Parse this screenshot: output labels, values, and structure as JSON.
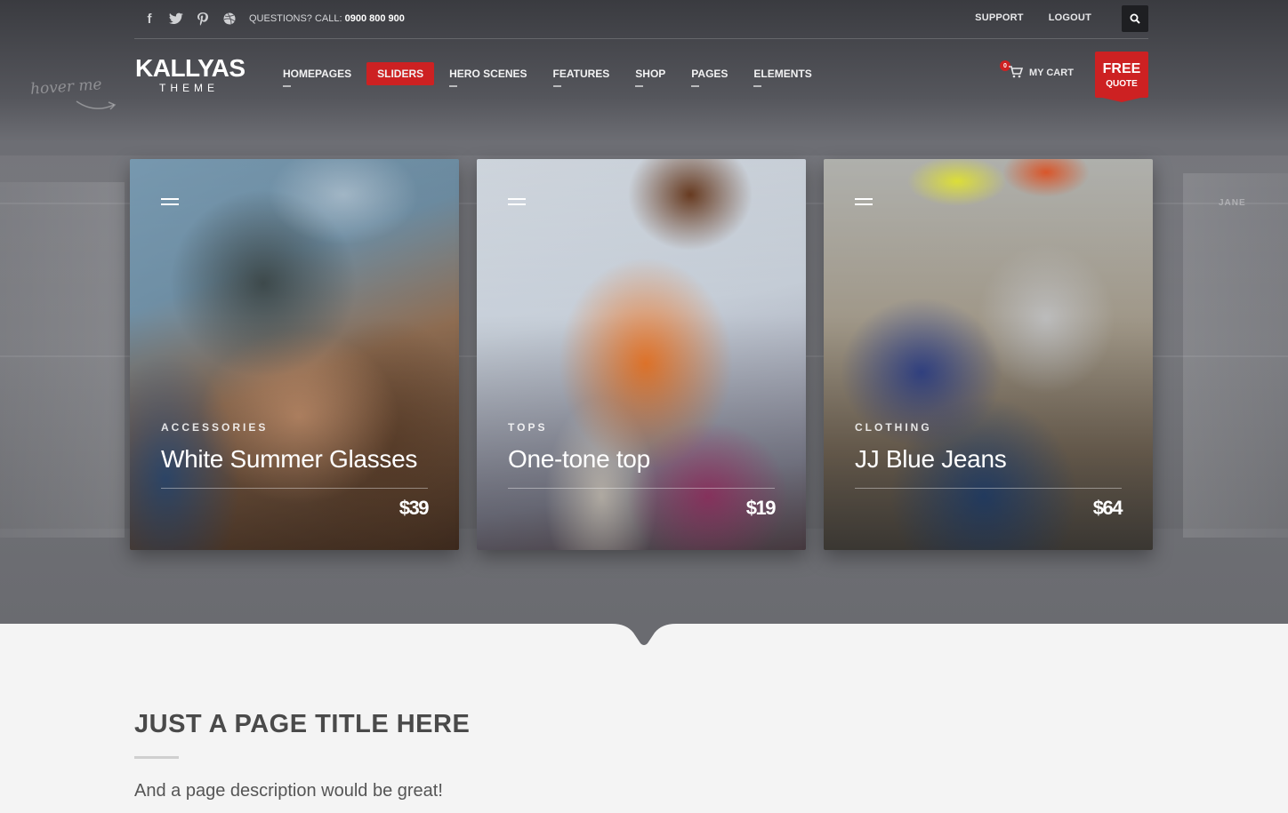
{
  "topbar": {
    "social": [
      "facebook-icon",
      "twitter-icon",
      "pinterest-icon",
      "dribbble-icon"
    ],
    "questions_prefix": "QUESTIONS? CALL:",
    "phone": "0900 800 900",
    "links": [
      "SUPPORT",
      "LOGOUT"
    ],
    "search_icon": "search-icon"
  },
  "logo": {
    "line1": "KALLYAS",
    "line2": "THEME"
  },
  "hover_hint": "hover me",
  "nav": {
    "items": [
      "HOMEPAGES",
      "SLIDERS",
      "HERO SCENES",
      "FEATURES",
      "SHOP",
      "PAGES",
      "ELEMENTS"
    ],
    "active": "SLIDERS"
  },
  "cart": {
    "count": "0",
    "label": "MY CART"
  },
  "quote": {
    "line1": "FREE",
    "line2": "QUOTE"
  },
  "bg_label": "JANE",
  "cards": [
    {
      "category": "ACCESSORIES",
      "title": "White Summer Glasses",
      "price": "$39"
    },
    {
      "category": "TOPS",
      "title": "One-tone top",
      "price": "$19"
    },
    {
      "category": "CLOTHING",
      "title": "JJ Blue Jeans",
      "price": "$64"
    }
  ],
  "content": {
    "title": "JUST A PAGE TITLE HERE",
    "description": "And a page description would be great!"
  },
  "colors": {
    "accent": "#cd2122",
    "hero_bg": "#6d6e74",
    "content_bg": "#f4f4f4"
  }
}
